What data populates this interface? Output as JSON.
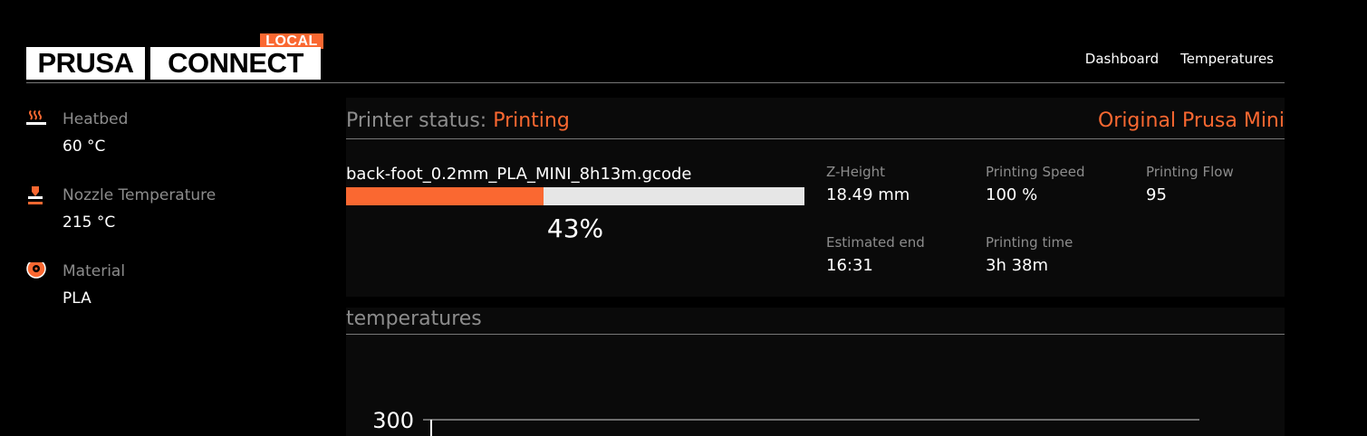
{
  "brand": {
    "word1": "PRUSA",
    "word2": "CONNECT",
    "badge": "LOCAL"
  },
  "nav": {
    "tabs": [
      {
        "label": "Dashboard",
        "active": true
      },
      {
        "label": "Temperatures",
        "active": false
      }
    ]
  },
  "sidebar": {
    "items": [
      {
        "icon": "heatbed-icon",
        "label": "Heatbed",
        "value": "60 °C"
      },
      {
        "icon": "nozzle-icon",
        "label": "Nozzle Temperature",
        "value": "215 °C"
      },
      {
        "icon": "filament-spool-icon",
        "label": "Material",
        "value": "PLA"
      }
    ]
  },
  "status": {
    "label": "Printer status:",
    "value": "Printing",
    "printer": "Original Prusa Mini"
  },
  "job": {
    "filename": "back-foot_0.2mm_PLA_MINI_8h13m.gcode",
    "progress": 0.43,
    "progress_text": "43%"
  },
  "stats": {
    "z_height": {
      "label": "Z-Height",
      "value": "18.49 mm"
    },
    "speed": {
      "label": "Printing Speed",
      "value": "100 %"
    },
    "flow": {
      "label": "Printing Flow",
      "value": "95"
    },
    "estimated_end": {
      "label": "Estimated end",
      "value": "16:31"
    },
    "printing_time": {
      "label": "Printing time",
      "value": "3h 38m"
    }
  },
  "temperatures": {
    "title": "temperatures"
  },
  "chart_data": {
    "type": "line",
    "title": "temperatures",
    "ytick_labels": [
      "300"
    ],
    "ylim_top": 300,
    "series": []
  },
  "colors": {
    "accent": "#fa6831",
    "background": "#000000",
    "muted": "#8c8c8c",
    "progress_track": "#e6e6e6"
  }
}
